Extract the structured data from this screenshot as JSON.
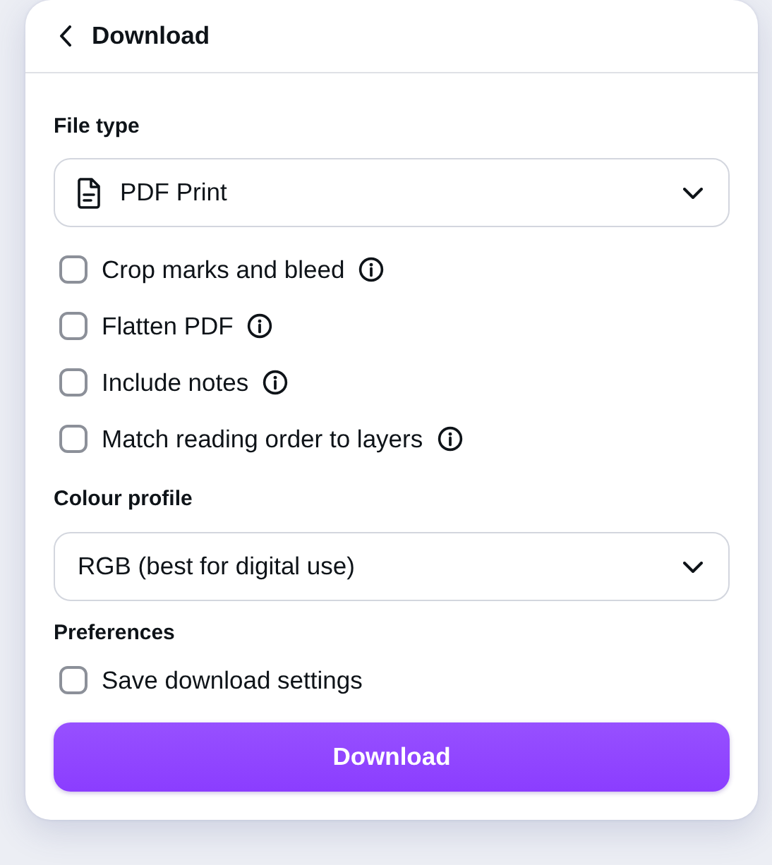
{
  "header": {
    "title": "Download"
  },
  "file_type": {
    "label": "File type",
    "value": "PDF Print"
  },
  "options": [
    {
      "label": "Crop marks and bleed",
      "checked": false,
      "info": true
    },
    {
      "label": "Flatten PDF",
      "checked": false,
      "info": true
    },
    {
      "label": "Include notes",
      "checked": false,
      "info": true
    },
    {
      "label": "Match reading order to layers",
      "checked": false,
      "info": true
    }
  ],
  "colour_profile": {
    "label": "Colour profile",
    "value": "RGB (best for digital use)"
  },
  "preferences": {
    "label": "Preferences",
    "options": [
      {
        "label": "Save download settings",
        "checked": false,
        "info": false
      }
    ]
  },
  "button": "Download"
}
